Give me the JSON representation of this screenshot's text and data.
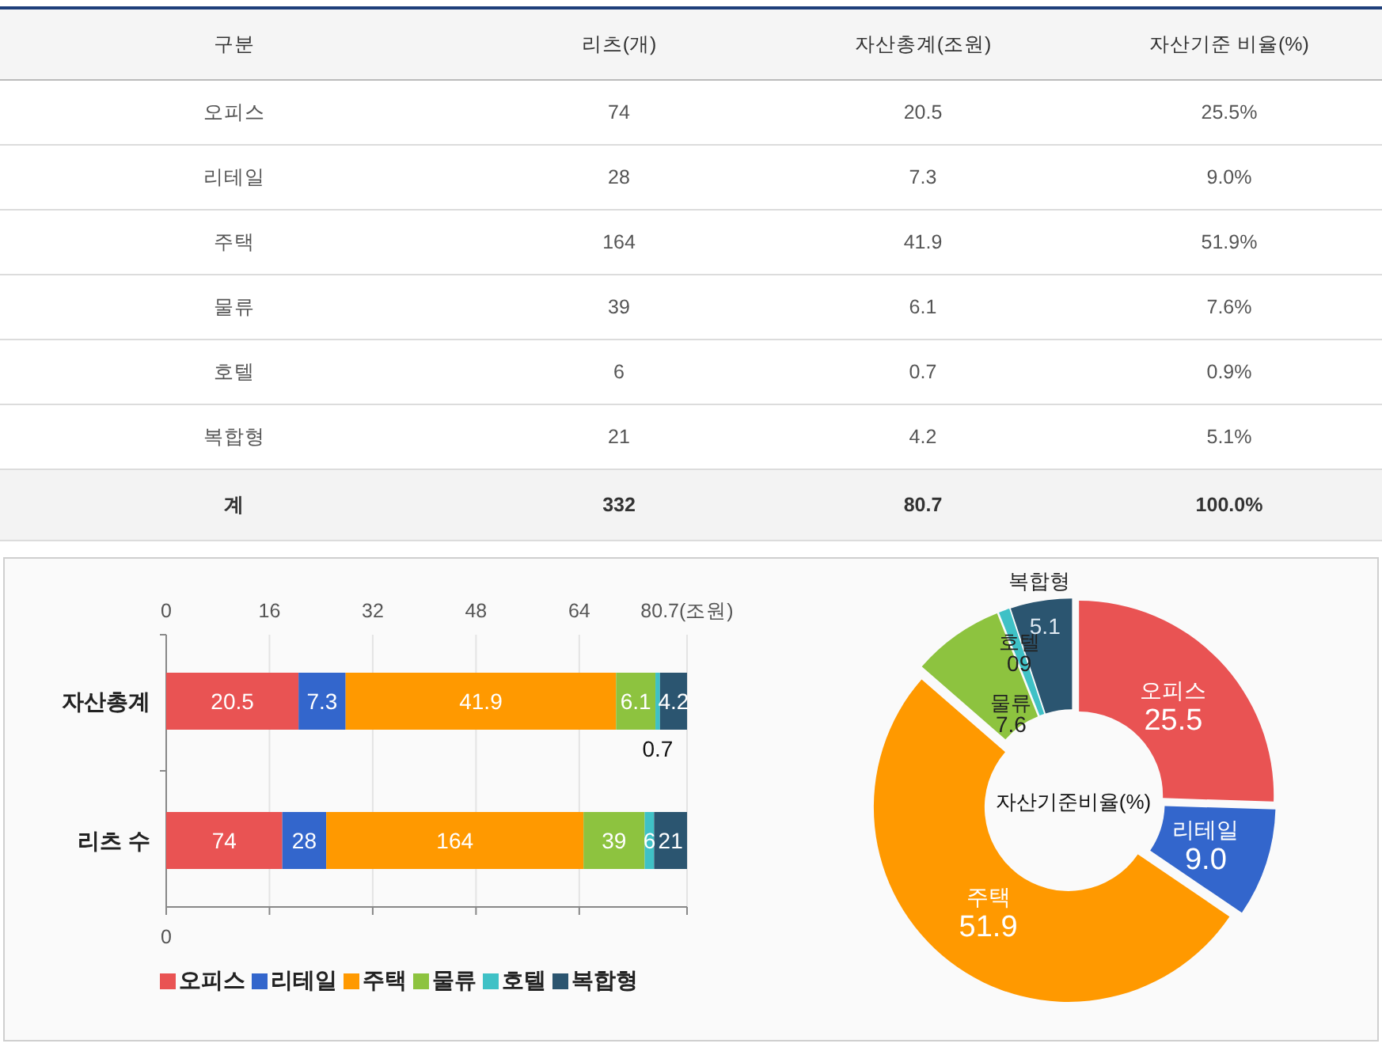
{
  "table": {
    "columns": [
      "구분",
      "리츠(개)",
      "자산총계(조원)",
      "자산기준 비율(%)"
    ],
    "rows": [
      [
        "오피스",
        "74",
        "20.5",
        "25.5%"
      ],
      [
        "리테일",
        "28",
        "7.3",
        "9.0%"
      ],
      [
        "주택",
        "164",
        "41.9",
        "51.9%"
      ],
      [
        "물류",
        "39",
        "6.1",
        "7.6%"
      ],
      [
        "호텔",
        "6",
        "0.7",
        "0.9%"
      ],
      [
        "복합형",
        "21",
        "4.2",
        "5.1%"
      ]
    ],
    "total": [
      "계",
      "332",
      "80.7",
      "100.0%"
    ]
  },
  "asset_bar_chart": {
    "chart_data": {
      "type": "bar",
      "orientation": "horizontal",
      "stacked": true,
      "data_labels": true,
      "categories": [
        "자산총계"
      ],
      "series": [
        {
          "name": "오피스",
          "color": "#e95353",
          "values": [
            20.5
          ]
        },
        {
          "name": "리테일",
          "color": "#3366cc",
          "values": [
            7.3
          ]
        },
        {
          "name": "주택",
          "color": "#ff9900",
          "values": [
            41.9
          ]
        },
        {
          "name": "물류",
          "color": "#8dc33f",
          "values": [
            6.1
          ]
        },
        {
          "name": "호텔",
          "color": "#3fc1c6",
          "values": [
            0.7
          ]
        },
        {
          "name": "복합형",
          "color": "#2b5570",
          "values": [
            4.2
          ]
        }
      ],
      "xlim": [
        0,
        80.7
      ],
      "grid": true,
      "xticks": [
        0,
        16,
        32,
        48,
        64,
        {
          "value": 80.7,
          "label": "80.7(조원)"
        }
      ]
    }
  },
  "reits_bar_chart": {
    "chart_data": {
      "type": "bar",
      "orientation": "horizontal",
      "stacked": true,
      "data_labels": true,
      "categories": [
        "리츠 수"
      ],
      "series": [
        {
          "color": "#e95353",
          "values": [
            74
          ]
        },
        {
          "color": "#3366cc",
          "values": [
            28
          ]
        },
        {
          "color": "#ff9900",
          "values": [
            164
          ]
        },
        {
          "color": "#8dc33f",
          "values": [
            39
          ]
        },
        {
          "color": "#3fc1c6",
          "values": [
            6
          ]
        },
        {
          "color": "#2b5570",
          "values": [
            21
          ]
        }
      ],
      "xlim": [
        0,
        332
      ],
      "annotations": [
        {
          "text": "0"
        }
      ]
    }
  },
  "ratio_donut_chart": {
    "chart_data": {
      "type": "donut",
      "title": "자산기준비율(%)",
      "categories": [
        "오피스",
        "리테일",
        "주택",
        "물류",
        "호텔",
        "복합형"
      ],
      "colors": [
        "#e95353",
        "#3366cc",
        "#ff9900",
        "#8dc33f",
        "#3fc1c6",
        "#2b5570"
      ],
      "series": [
        {
          "values": [
            25.5,
            9.0,
            51.9,
            7.6,
            0.9,
            5.1
          ]
        }
      ],
      "value_labels": [
        "25.5",
        "9.0",
        "51.9",
        "7.6",
        "09",
        "5.1"
      ]
    }
  }
}
